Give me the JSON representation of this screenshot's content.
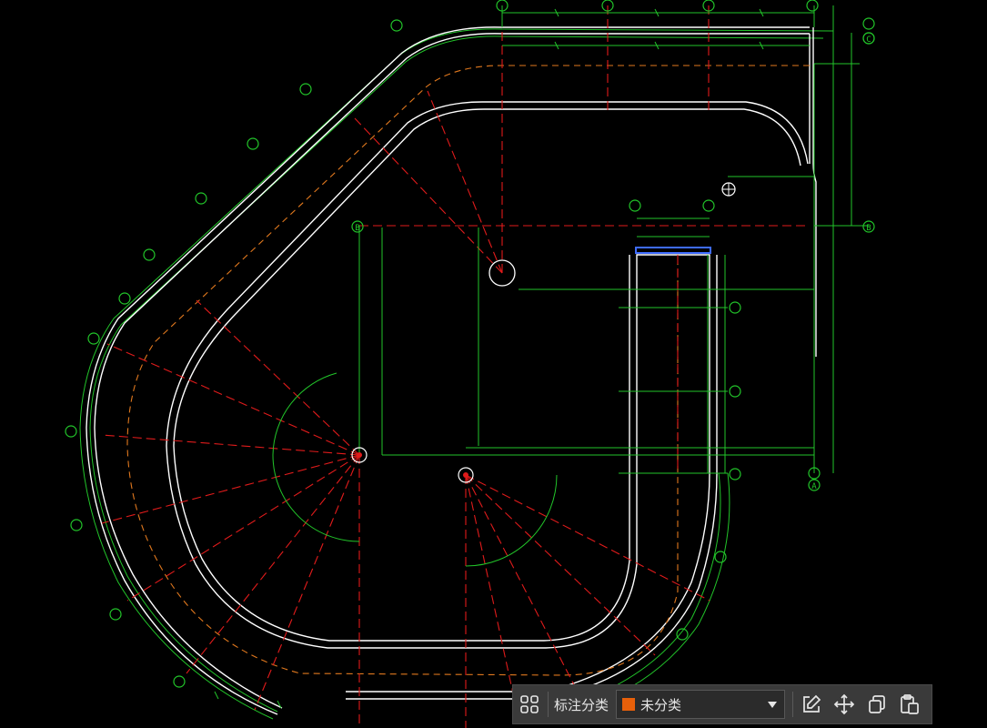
{
  "colors": {
    "background": "#000000",
    "green": "#22c52a",
    "red": "#e01b1b",
    "white": "#ffffff",
    "orange": "#e0781e",
    "blue": "#3f6cff",
    "toolbar_bg": "#3a3a3a",
    "swatch": "#e8600a"
  },
  "grid_bubbles": [
    "B",
    "B",
    "C",
    "A"
  ],
  "toolbar": {
    "grid_icon": "grid-four-icon",
    "label": "标注分类",
    "category_value": "未分类",
    "category_color": "#e8600a",
    "edit_icon": "edit-icon",
    "move_icon": "move-icon",
    "copy_icon": "copy-icon",
    "paste_icon": "paste-icon"
  }
}
